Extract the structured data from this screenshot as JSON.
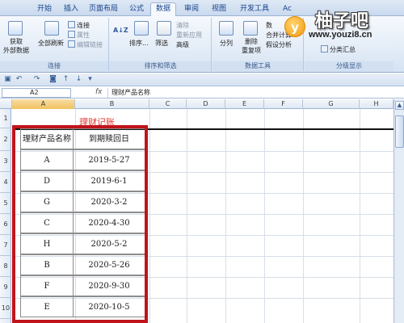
{
  "ribbon_tabs": [
    "开始",
    "插入",
    "页面布局",
    "公式",
    "数据",
    "审阅",
    "视图",
    "开发工具",
    "Ac"
  ],
  "active_tab": "数据",
  "ribbon": {
    "get_external_data": "获取\n外部数据",
    "refresh_all": "全部刷新",
    "connections": "连接",
    "properties": "属性",
    "edit_links": "编辑链接",
    "connections_group": "连接",
    "sort_az": "A↓Z",
    "sort": "排序...",
    "filter": "筛选",
    "clear": "清除",
    "reapply": "重新应用",
    "advanced": "高级",
    "sort_filter_group": "排序和筛选",
    "text_to_columns": "分列",
    "remove_duplicates": "删除\n重复项",
    "data_validation": "数",
    "consolidate": "合并计算",
    "what_if": "假设分析",
    "data_tools_group": "数据工具",
    "subtotal": "分类汇总",
    "outline_group": "分级显示"
  },
  "watermark": {
    "brand": "柚子吧",
    "url": "www.youzi8.cn",
    "badge": "y"
  },
  "formula_bar": {
    "name_box": "A2",
    "fx": "fx",
    "content": "理财产品名称"
  },
  "columns": [
    "A",
    "B",
    "C",
    "D",
    "E",
    "F",
    "G",
    "H"
  ],
  "rows": [
    "1",
    "2",
    "3",
    "4",
    "5",
    "6",
    "7",
    "8",
    "9",
    "10"
  ],
  "sheet": {
    "title": "理财记账",
    "headers": [
      "理财产品名称",
      "到期赎回日"
    ],
    "records": [
      [
        "A",
        "2019-5-27"
      ],
      [
        "D",
        "2019-6-1"
      ],
      [
        "G",
        "2020-3-2"
      ],
      [
        "C",
        "2020-4-30"
      ],
      [
        "H",
        "2020-5-2"
      ],
      [
        "B",
        "2020-5-26"
      ],
      [
        "F",
        "2020-9-30"
      ],
      [
        "E",
        "2020-10-5"
      ]
    ]
  },
  "colors": {
    "highlight_box": "#c0141b",
    "title_text": "#e0352b"
  }
}
